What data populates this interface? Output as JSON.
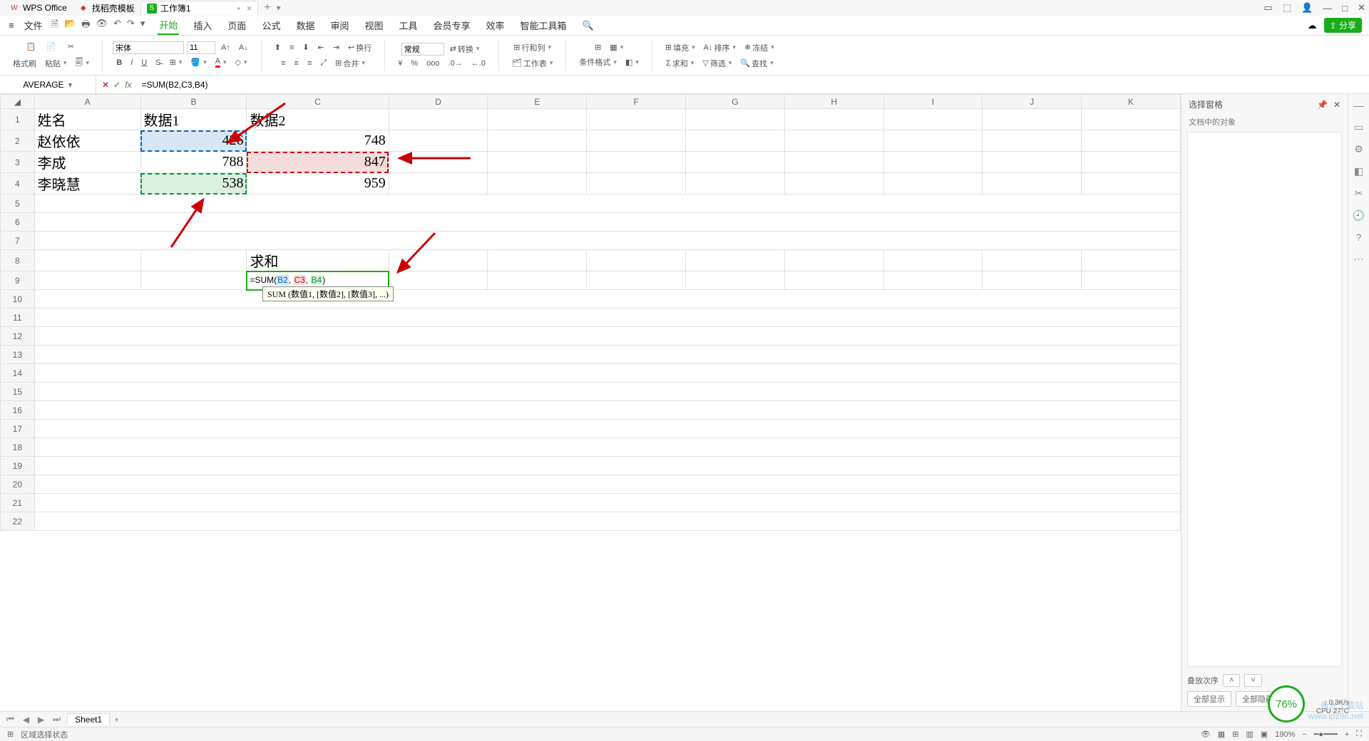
{
  "tabs": {
    "t1": "WPS Office",
    "t2": "找稻壳模板",
    "t3": "工作簿1"
  },
  "menus": {
    "file": "文件",
    "start": "开始",
    "insert": "插入",
    "page": "页面",
    "formula": "公式",
    "data": "数据",
    "review": "审阅",
    "view": "视图",
    "tool": "工具",
    "member": "会员专享",
    "effect": "效率",
    "smart": "智能工具箱"
  },
  "ribbon": {
    "fmtbrush": "格式刷",
    "paste": "粘贴",
    "font": "宋体",
    "size": "11",
    "general": "常规",
    "convert": "转换",
    "rowcol": "行和列",
    "ws": "工作表",
    "condfmt": "条件格式",
    "fill": "填充",
    "sort": "排序",
    "freeze": "冻结",
    "sum": "求和",
    "filter": "筛选",
    "find": "查找",
    "wrap": "换行",
    "merge": "合并"
  },
  "fbar": {
    "name": "AVERAGE",
    "formula": "=SUM(B2,C3,B4)"
  },
  "cols": [
    "A",
    "B",
    "C",
    "D",
    "E",
    "F",
    "G",
    "H",
    "I",
    "J",
    "K"
  ],
  "rows": [
    1,
    2,
    3,
    4,
    5,
    6,
    7,
    8,
    9,
    10,
    11,
    12,
    13,
    14,
    15,
    16,
    17,
    18,
    19,
    20,
    21,
    22
  ],
  "cells": {
    "A1": "姓名",
    "B1": "数据1",
    "C1": "数据2",
    "A2": "赵依依",
    "B2": "426",
    "C2": "748",
    "A3": "李成",
    "B3": "788",
    "C3": "847",
    "A4": "李晓慧",
    "B4": "538",
    "C4": "959",
    "C8": "求和"
  },
  "edit": {
    "prefix": "=SUM(",
    "r1": "B2",
    "c1": ", ",
    "r2": "C3",
    "c2": ", ",
    "r3": "B4",
    "suffix": ")"
  },
  "tooltip": "SUM (数值1, [数值2], [数值3], ...)",
  "rpane": {
    "title": "选择窗格",
    "sub": "文档中的对象",
    "stack": "叠放次序",
    "showall": "全部显示",
    "hideall": "全部隐藏"
  },
  "sheettab": "Sheet1",
  "status": {
    "mode": "区域选择状态",
    "zoom": "190%"
  },
  "badge": "76%",
  "net": "0.3K/s",
  "cpu": "CPU 27°C",
  "watermark1": "极光下载站",
  "watermark2": "www.ipz9n.net",
  "share": "分享"
}
